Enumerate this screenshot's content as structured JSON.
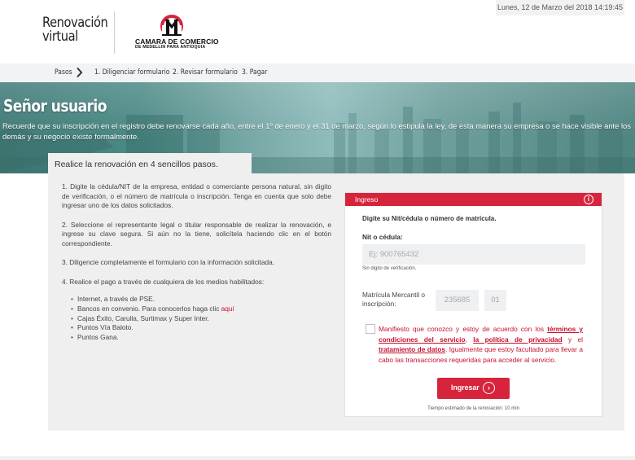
{
  "header": {
    "brand_line1": "Renovación",
    "brand_line2": "virtual",
    "logo_line1": "CAMARA DE COMERCIO",
    "logo_line2": "DE MEDELLIN PARA ANTIOQUIA",
    "datetime": "Lunes, 12 de Marzo del 2018 14:19:45"
  },
  "steps": {
    "label": "Pasos",
    "items": [
      "1. Diligenciar formulario",
      "2. Revisar formulario",
      "3. Pagar"
    ]
  },
  "banner": {
    "title": "Señor usuario",
    "text": "Recuerde que su inscripción en el registro debe renovarse cada año, entre el 1º de enero y el 31 de marzo, según lo estipula la ley, de esta manera su empresa o se hace visible ante los demás y su negocio existe formalmente."
  },
  "main": {
    "title": "Realice la renovación en 4 sencillos pasos.",
    "step1": "1. Digite la cédula/NIT de la empresa, entidad o comerciante persona natural, sin digito de verificación, o el número de matrícula o inscripción. Tenga en cuenta que solo debe ingresar uno de los datos solicitados.",
    "step2": "2. Seleccione el representante legal o titular responsable de realizar la renovación, e ingrese su clave segura. Si aún no la tiene, solicítela haciendo clic en el botón correspondiente.",
    "step3": "3. Diligencie completamente el formulario con la información solicitada.",
    "step4": "4. Realice el pago a través de cualquiera de los medios habilitados:",
    "payment": {
      "pse": "Internet, a través de PSE.",
      "banks": "Bancos en convenio. Para conocerlos haga clic ",
      "banks_link": "aquí",
      "cajas": "Cajas Éxito, Carulla, Surtimax y Super Inter.",
      "baloto": "Puntos Vía Baloto.",
      "gana": "Puntos Gana."
    }
  },
  "login": {
    "header": "Ingreso",
    "info_icon": "i",
    "subtitle": "Digite su Nit/cédula o número de matrícula.",
    "nit_label": "Nit o cédula:",
    "nit_placeholder": "Ej: 900765432",
    "nit_hint": "Sin digito de verificación.",
    "matricula_label": "Matrícula Mercantil o inscripción:",
    "matricula_placeholder": "235685",
    "matricula_suffix_placeholder": "01",
    "terms_a": "Manifiesto que conozco y estoy de acuerdo con los ",
    "terms_link1": "términos y condiciones del servicio",
    "terms_b": ", ",
    "terms_link2": "la política de privacidad",
    "terms_c": " y el ",
    "terms_link3": "tratamiento de datos",
    "terms_d": ". Igualmente que estoy facultado para llevar a cabo las transacciones requeridas para acceder al servicio.",
    "button": "Ingresar",
    "button_arrow": "›",
    "time": "Tiempo estimado de la renovación: 10 min"
  },
  "colors": {
    "accent": "#d7243d",
    "banner_teal": "#4c8a86"
  }
}
